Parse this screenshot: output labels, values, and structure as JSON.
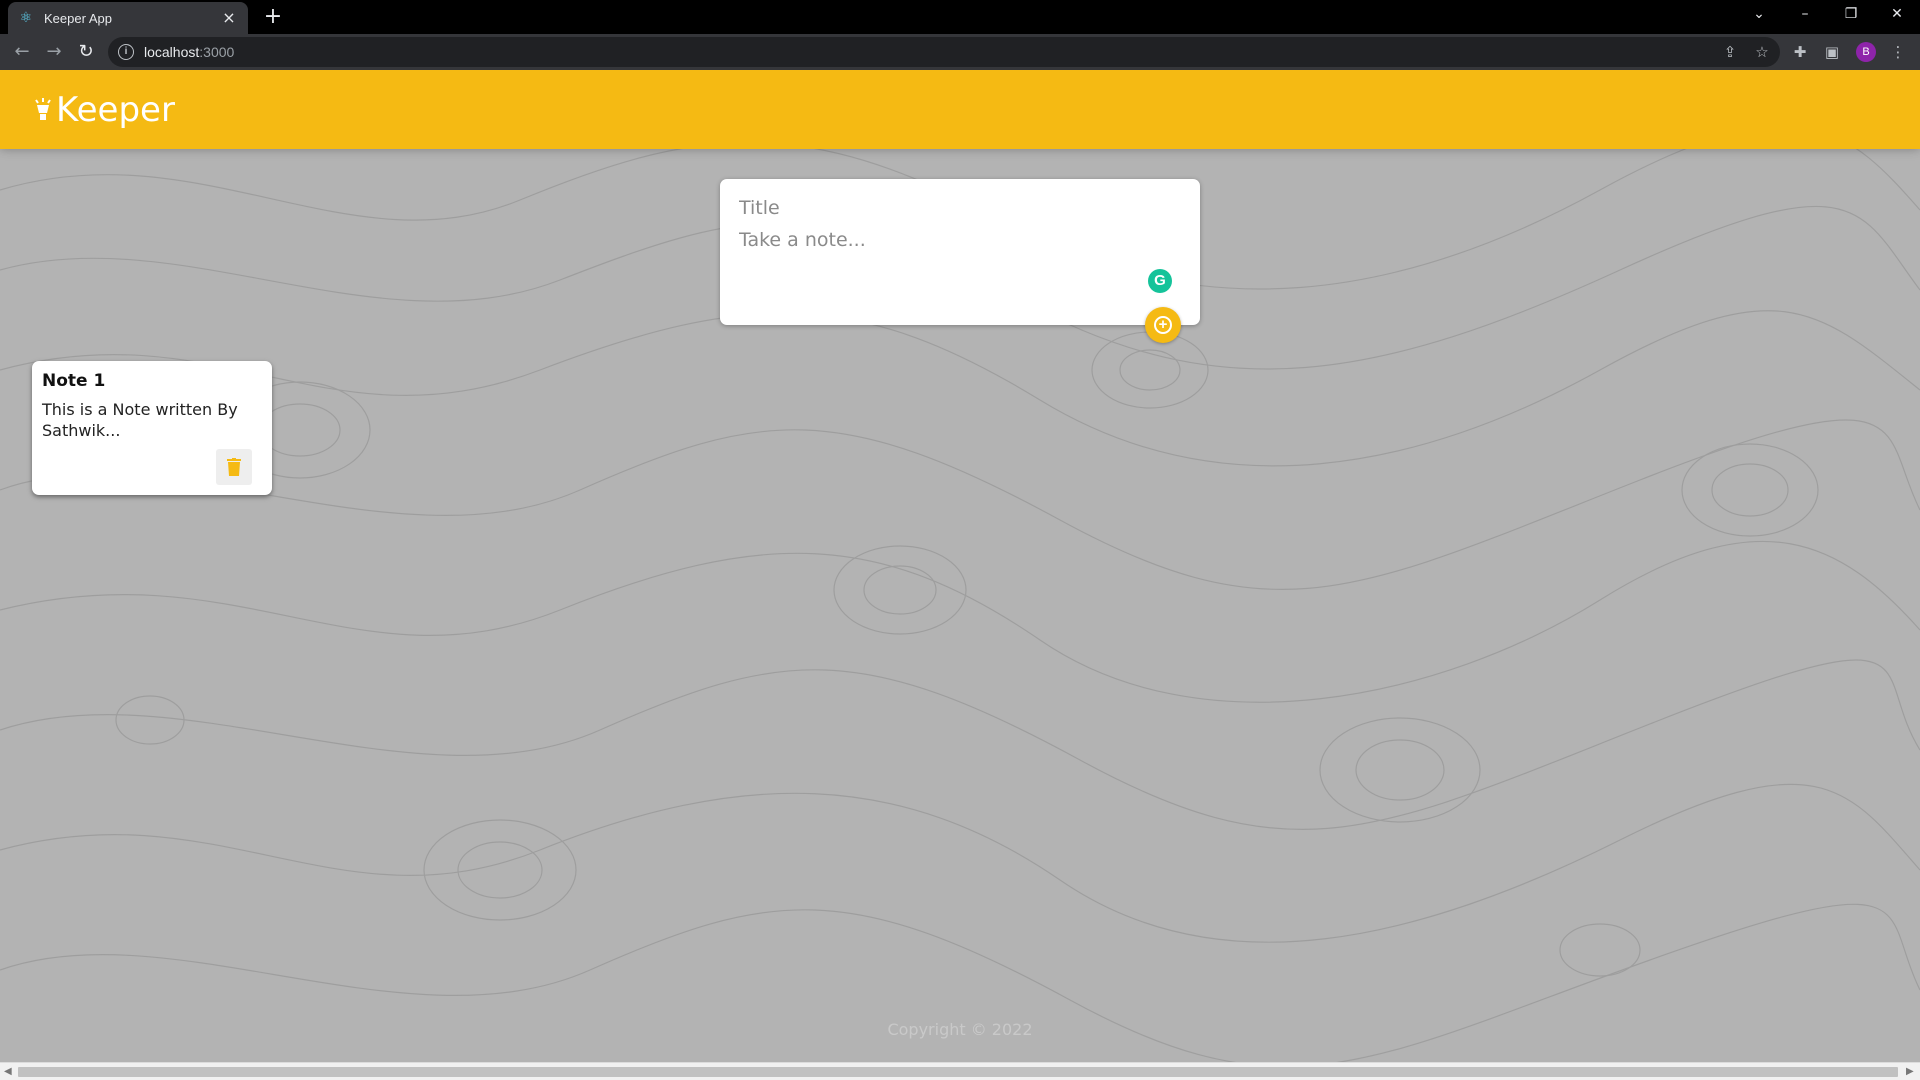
{
  "browser": {
    "tab_title": "Keeper App",
    "tab_favicon": "react-atom-icon",
    "tab_close": "×",
    "new_tab": "+",
    "url_host": "localhost",
    "url_port": ":3000",
    "profile_initial": "B"
  },
  "app": {
    "brand": "Keeper",
    "brand_color": "#f5ba13"
  },
  "create_note": {
    "title_placeholder": "Title",
    "content_placeholder": "Take a note...",
    "add_icon": "plus-circle-icon"
  },
  "notes": [
    {
      "title": "Note 1",
      "content": "This is a Note written By Sathwik..."
    }
  ],
  "footer": {
    "text": "Copyright © 2022"
  }
}
